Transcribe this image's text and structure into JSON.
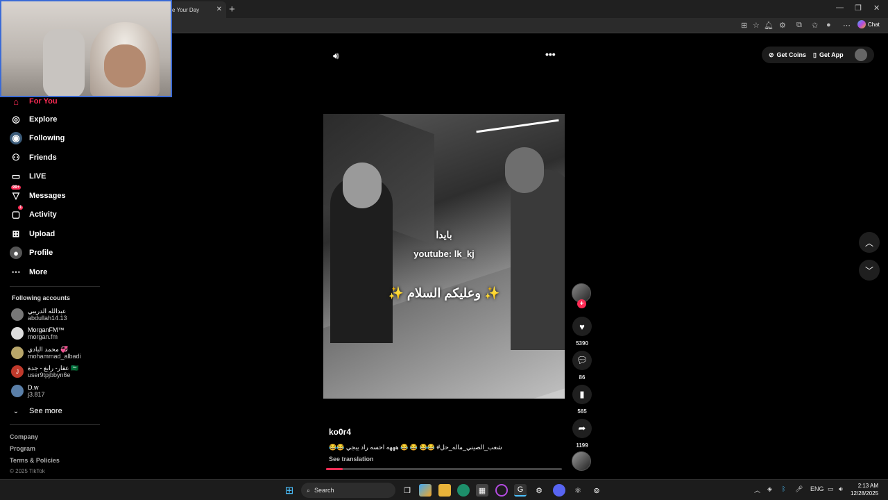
{
  "browser": {
    "tab_title": "ke Your Day",
    "tab_close": "✕",
    "new_tab": "+",
    "chat_label": "Chat"
  },
  "sidebar": {
    "items": [
      {
        "label": "For You",
        "icon": "home-icon"
      },
      {
        "label": "Explore",
        "icon": "compass-icon"
      },
      {
        "label": "Following",
        "icon": "following-icon"
      },
      {
        "label": "Friends",
        "icon": "friends-icon"
      },
      {
        "label": "LIVE",
        "icon": "live-icon"
      },
      {
        "label": "Messages",
        "icon": "messages-icon",
        "badge": "99+"
      },
      {
        "label": "Activity",
        "icon": "activity-icon",
        "badge": "1"
      },
      {
        "label": "Upload",
        "icon": "upload-icon"
      },
      {
        "label": "Profile",
        "icon": "profile-icon"
      },
      {
        "label": "More",
        "icon": "more-icon"
      }
    ],
    "following_title": "Following accounts",
    "accounts": [
      {
        "name": "عبدالله الدريبي",
        "user": "abdullah14.13"
      },
      {
        "name": "MorganFM™",
        "user": "morgan.fm"
      },
      {
        "name": "محمد البادي 💞",
        "user": "mohammad_albadi"
      },
      {
        "name": "عقار- رابغ - جدة 🇸🇦",
        "user": "user9tpjbbyn6e",
        "initial": "J"
      },
      {
        "name": "D.w",
        "user": "j3.817"
      }
    ],
    "see_more": "See more",
    "footer": {
      "company": "Company",
      "program": "Program",
      "terms": "Terms & Policies",
      "copyright": "© 2025 TikTok"
    }
  },
  "topbar": {
    "get_coins": "Get Coins",
    "get_app": "Get App"
  },
  "video": {
    "overlay_top": "بايدا",
    "overlay_watermark": "youtube: lk_kj",
    "overlay_main": "✨ وعليكم السلام ✨",
    "author": "ko0r4",
    "caption": "😂😂 شعب_الصيني_ماله_حل# 😂😂 😂 😂 هههه احسه راد يبجي",
    "see_translation": "See translation",
    "progress": 0.07,
    "likes": "5390",
    "comments": "86",
    "saves": "565",
    "shares": "1199"
  },
  "taskbar": {
    "search_label": "Search",
    "lang": "ENG",
    "time": "2:13 AM",
    "date": "12/28/2025"
  },
  "colors": {
    "accent": "#fe2c55",
    "background": "#000000"
  }
}
